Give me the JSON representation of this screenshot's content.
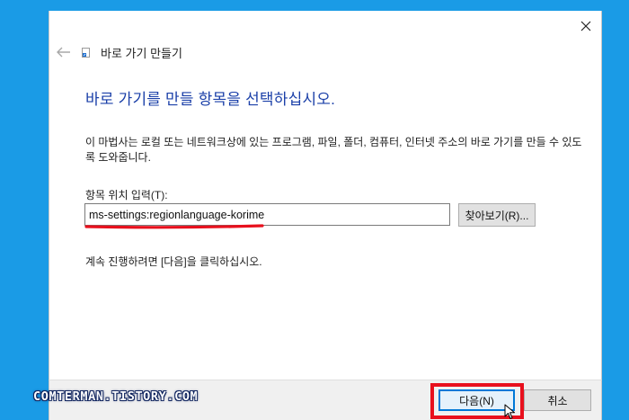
{
  "dialog": {
    "title": "바로 가기 만들기",
    "heading": "바로 가기를 만들 항목을 선택하십시오.",
    "description": "이 마법사는 로컬 또는 네트워크상에 있는 프로그램, 파일, 폴더, 컴퓨터, 인터넷 주소의 바로 가기를 만들 수 있도록 도와줍니다.",
    "location_label": "항목 위치 입력(T):",
    "location_value": "ms-settings:regionlanguage-korime",
    "browse_label": "찾아보기(R)...",
    "continue_instruction": "계속 진행하려면 [다음]을 클릭하십시오.",
    "next_label": "다음(N)",
    "cancel_label": "취소"
  },
  "watermark": "COMTERMAN.TISTORY.COM",
  "colors": {
    "desktop_background": "#1a9be6",
    "heading": "#1a3fa8",
    "annotation_red": "#e8101d",
    "focus_blue": "#0078d7"
  },
  "icons": {
    "back": "back-arrow-icon",
    "close": "close-icon",
    "title": "shortcut-icon",
    "cursor": "mouse-cursor-icon"
  }
}
